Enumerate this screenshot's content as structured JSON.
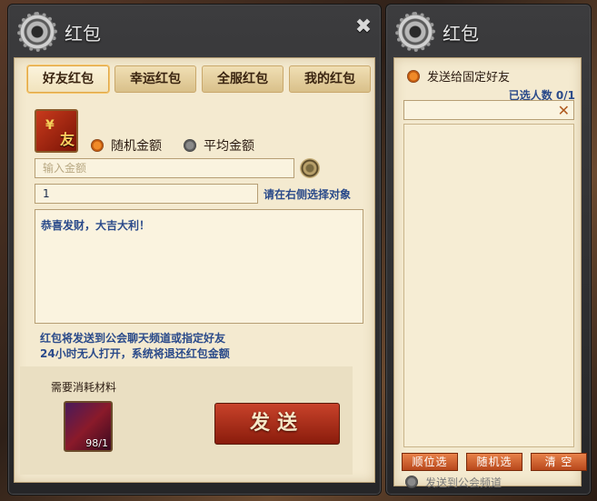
{
  "left_window": {
    "title": "红包",
    "tabs": [
      {
        "label": "好友红包",
        "active": true
      },
      {
        "label": "幸运红包"
      },
      {
        "label": "全服红包"
      },
      {
        "label": "我的红包"
      }
    ],
    "item_icon_text": "友",
    "radio_random": "随机金额",
    "radio_average": "平均金额",
    "selected_radio": "随机金额",
    "amount_placeholder": "输入金额",
    "count_value": "1",
    "select_hint": "请在右侧选择对象",
    "message": "恭喜发财，大吉大利！",
    "note_line1": "红包将发送到公会聊天频道或指定好友",
    "note_line2": "24小时无人打开，系统将退还红包金额",
    "material_label": "需要消耗材料",
    "material_count": "98/1",
    "send_label": "发送"
  },
  "right_window": {
    "title": "红包",
    "fixed_friend_label": "发送给固定好友",
    "selected_count": "已选人数 0/1",
    "buttons": [
      "顺位选",
      "随机选",
      "清 空"
    ],
    "guild_channel_label": "发送到公会频道"
  },
  "colors": {
    "accent": "#f08a28",
    "send_button": "#a82c16",
    "hint_text": "#2a4a8a",
    "parchment": "#f4ead0"
  }
}
